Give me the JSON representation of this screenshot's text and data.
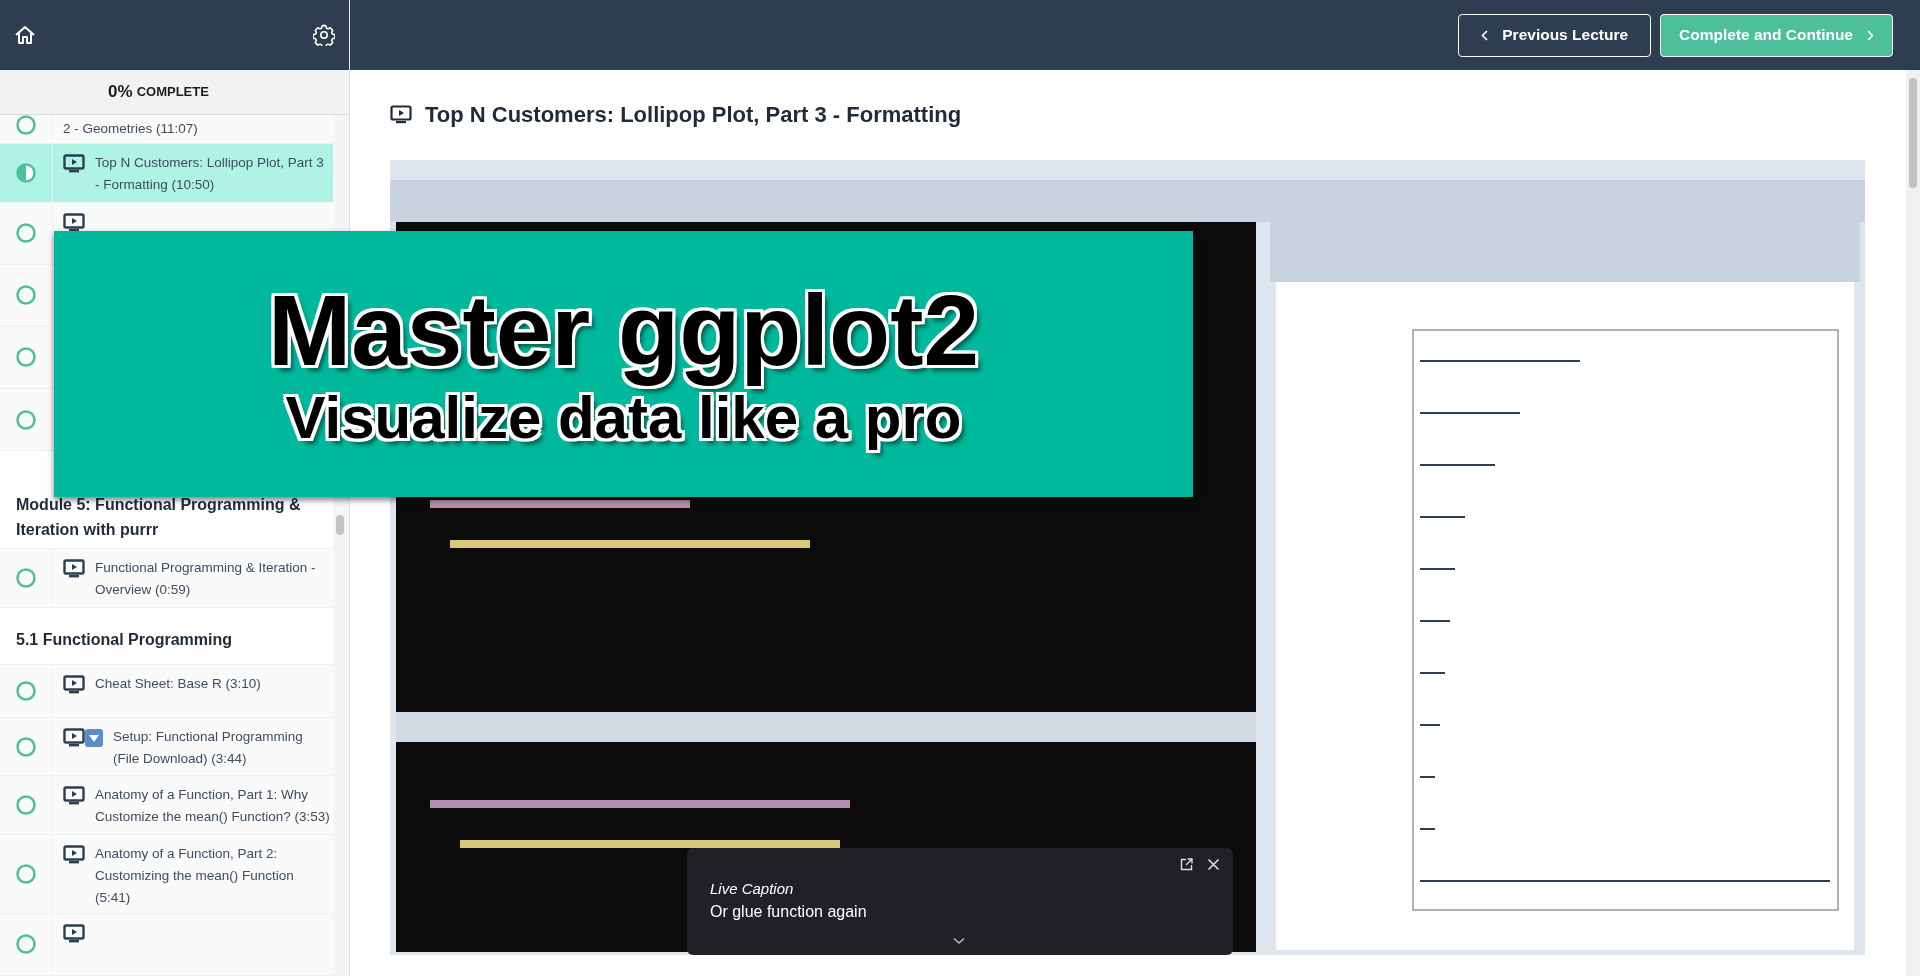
{
  "progress": {
    "percent": "0%",
    "label": "COMPLETE"
  },
  "sidebar": [
    {
      "kind": "lecture",
      "title": "2 - Geometries (11:07)",
      "started": false,
      "selected": false
    },
    {
      "kind": "lecture",
      "title": "Top N Customers: Lollipop Plot, Part 3 - Formatting (10:50)",
      "started": true,
      "selected": true
    },
    {
      "kind": "lecture",
      "started": false,
      "selected": false
    },
    {
      "kind": "lecture",
      "started": false,
      "selected": false
    },
    {
      "kind": "lecture",
      "started": false,
      "selected": false
    },
    {
      "kind": "lecture",
      "started": false,
      "selected": false
    },
    {
      "kind": "heading",
      "title": "Module 5: Functional Programming & Iteration with purrr"
    },
    {
      "kind": "lecture",
      "title": "Functional Programming & Iteration - Overview (0:59)",
      "started": false,
      "selected": false
    },
    {
      "kind": "heading",
      "title": "5.1 Functional Programming"
    },
    {
      "kind": "lecture",
      "title": "Cheat Sheet: Base R (3:10)",
      "started": false,
      "selected": false
    },
    {
      "kind": "lecture",
      "title": "Setup: Functional Programming (File Download) (3:44)",
      "started": false,
      "selected": false,
      "download": true
    },
    {
      "kind": "lecture",
      "title": "Anatomy of a Function, Part 1: Why Customize the mean() Function? (3:53)",
      "started": false,
      "selected": false
    },
    {
      "kind": "lecture",
      "title": "Anatomy of a Function, Part 2: Customizing the mean() Function (5:41)",
      "started": false,
      "selected": false
    },
    {
      "kind": "lecture",
      "started": false,
      "selected": false
    }
  ],
  "nav": {
    "previous": "Previous Lecture",
    "next": "Complete and Continue"
  },
  "lecture": {
    "title": "Top N Customers: Lollipop Plot, Part 3 - Formatting"
  },
  "banner": {
    "title": "Master ggplot2",
    "subtitle": "Visualize data like a pro"
  },
  "live_caption": {
    "title": "Live Caption",
    "text": "Or glue function again"
  }
}
